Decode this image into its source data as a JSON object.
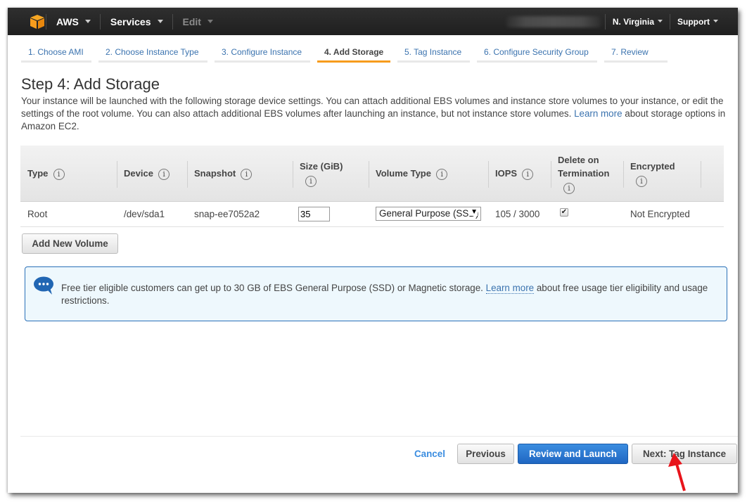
{
  "topnav": {
    "logo": "aws-cube-logo",
    "items": [
      {
        "label": "AWS",
        "icon": "chevron-down-icon"
      },
      {
        "label": "Services",
        "icon": "chevron-down-icon"
      },
      {
        "label": "Edit",
        "icon": "chevron-down-icon"
      }
    ],
    "region": "N. Virginia",
    "support": "Support"
  },
  "wizard": {
    "steps": [
      {
        "label": "1. Choose AMI",
        "active": false
      },
      {
        "label": "2. Choose Instance Type",
        "active": false
      },
      {
        "label": "3. Configure Instance",
        "active": false
      },
      {
        "label": "4. Add Storage",
        "active": true
      },
      {
        "label": "5. Tag Instance",
        "active": false
      },
      {
        "label": "6. Configure Security Group",
        "active": false
      },
      {
        "label": "7. Review",
        "active": false
      }
    ]
  },
  "page": {
    "title": "Step 4: Add Storage",
    "description_before_link": "Your instance will be launched with the following storage device settings. You can attach additional EBS volumes and instance store volumes to your instance, or edit the settings of the root volume. You can also attach additional EBS volumes after launching an instance, but not instance store volumes. ",
    "description_link": "Learn more",
    "description_after_link": " about storage options in Amazon EC2."
  },
  "table": {
    "headers": {
      "type": "Type",
      "device": "Device",
      "snapshot": "Snapshot",
      "size_l1": "Size (GiB)",
      "volume_type": "Volume Type",
      "iops": "IOPS",
      "delete_l1": "Delete on",
      "delete_l2": "Termination",
      "encrypted": "Encrypted"
    },
    "info_glyph": "i",
    "rows": [
      {
        "type": "Root",
        "device": "/dev/sda1",
        "snapshot": "snap-ee7052a2",
        "size": "35",
        "volume_type": "General Purpose (SSD)",
        "iops": "105 / 3000",
        "delete_on_termination": true,
        "encrypted": "Not Encrypted"
      }
    ]
  },
  "buttons": {
    "add_volume": "Add New Volume",
    "cancel": "Cancel",
    "previous": "Previous",
    "review_launch": "Review and Launch",
    "next": "Next: Tag Instance"
  },
  "infobox": {
    "text_before_link": "Free tier eligible customers can get up to 30 GB of EBS General Purpose (SSD) or Magnetic storage. ",
    "link": "Learn more",
    "text_after_link": " about free usage tier eligibility and usage restrictions."
  },
  "colors": {
    "accent_orange": "#f79c1d",
    "link_blue": "#3b73af",
    "primary_button": "#1f66c2",
    "annotation_arrow": "#e8141b"
  }
}
